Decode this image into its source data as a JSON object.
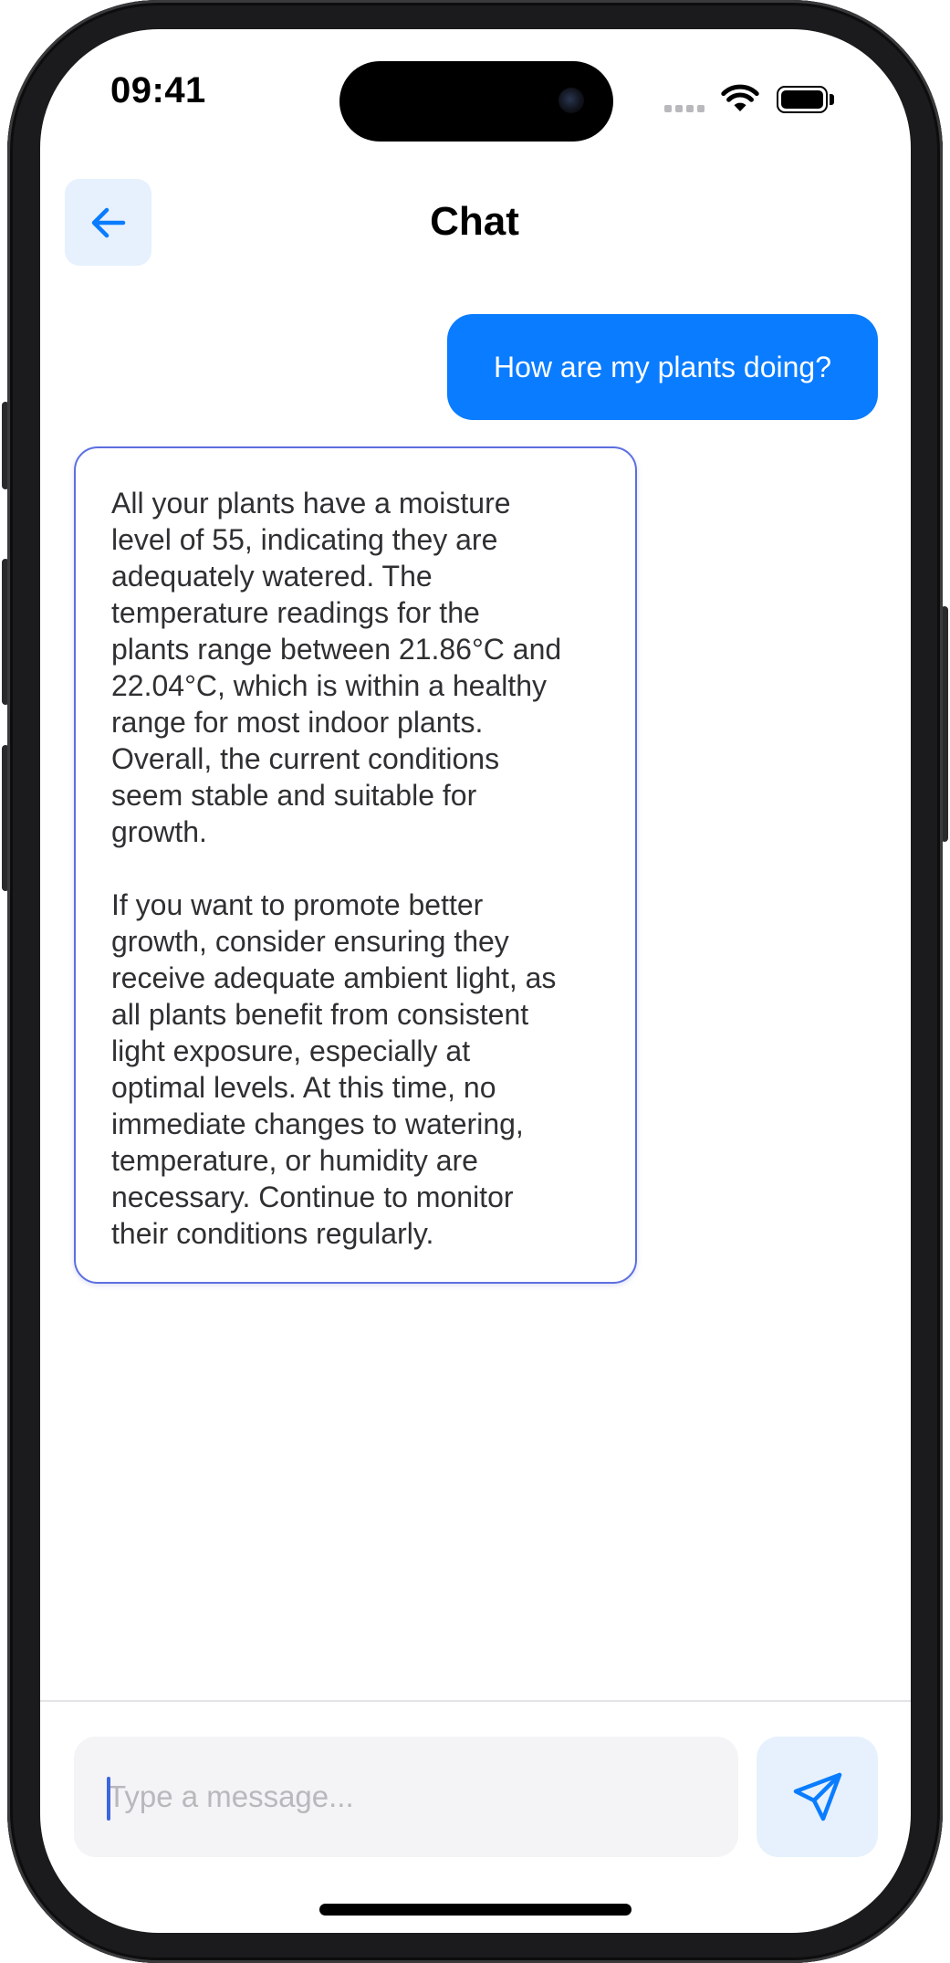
{
  "status_bar": {
    "time": "09:41",
    "icons": [
      "cellular-signal-icon",
      "wifi-icon",
      "battery-icon"
    ]
  },
  "header": {
    "title": "Chat",
    "back_icon": "arrow-left-icon"
  },
  "messages": [
    {
      "role": "user",
      "text": "How are my plants doing?"
    },
    {
      "role": "assistant",
      "paragraphs": [
        "All your plants have a moisture\nlevel of 55, indicating they are\nadequately watered. The\ntemperature readings for the\nplants range between 21.86°C and\n22.04°C, which is within a healthy\nrange for most indoor plants.\nOverall, the current conditions\nseem stable and suitable for\ngrowth.",
        "If you want to promote better\ngrowth, consider ensuring they\nreceive adequate ambient light, as\nall plants benefit from consistent\nlight exposure, especially at\noptimal levels. At this time, no\nimmediate changes to watering,\ntemperature, or humidity are\nnecessary. Continue to monitor\ntheir conditions regularly."
      ]
    }
  ],
  "composer": {
    "placeholder": "Type a message...",
    "value": "",
    "send_icon": "send-paper-plane-icon"
  },
  "colors": {
    "accent": "#0A7CFF",
    "accent_soft": "#E6F1FD",
    "bot_border": "#5C6FE0",
    "input_bg": "#F4F4F6"
  }
}
